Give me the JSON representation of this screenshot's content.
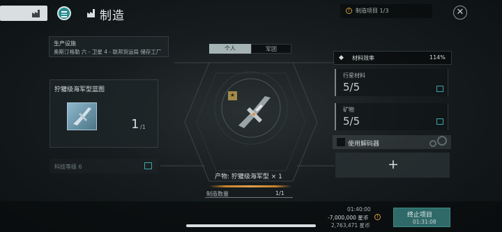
{
  "header": {
    "title": "制造",
    "notice": "制造项目 1/3",
    "notice_icon": "!",
    "close_icon": "✕"
  },
  "facility": {
    "label": "生产设施",
    "name": "奥斯汀格勒 六 - 卫星 4 - 联邦货运局 储存工厂"
  },
  "blueprint": {
    "title": "狞獾级海军型蓝图",
    "count": "1",
    "count_sub": "/1",
    "tech_level": "科技等级 6"
  },
  "tabs": {
    "personal": "个人",
    "corp": "军团"
  },
  "product": {
    "label": "产物:  狞獾级海军型 × 1",
    "star_badge": "★",
    "quantity_label": "制造数量",
    "quantity_value": "1/1"
  },
  "materials": {
    "efficiency_label": "材料效率",
    "efficiency_value": "114%",
    "efficiency_icon": "◆",
    "items": [
      {
        "label": "行星材料",
        "value": "5/5"
      },
      {
        "label": "矿物",
        "value": "5/5"
      }
    ]
  },
  "decoder": {
    "label": "使用解码器",
    "add": "+"
  },
  "footer": {
    "time": "01:40:00",
    "cost": "-7,000,000 星币",
    "cost_icon": "!",
    "balance": "2,763,471 星币",
    "end_label": "终止项目",
    "end_time": "01:31:08"
  }
}
